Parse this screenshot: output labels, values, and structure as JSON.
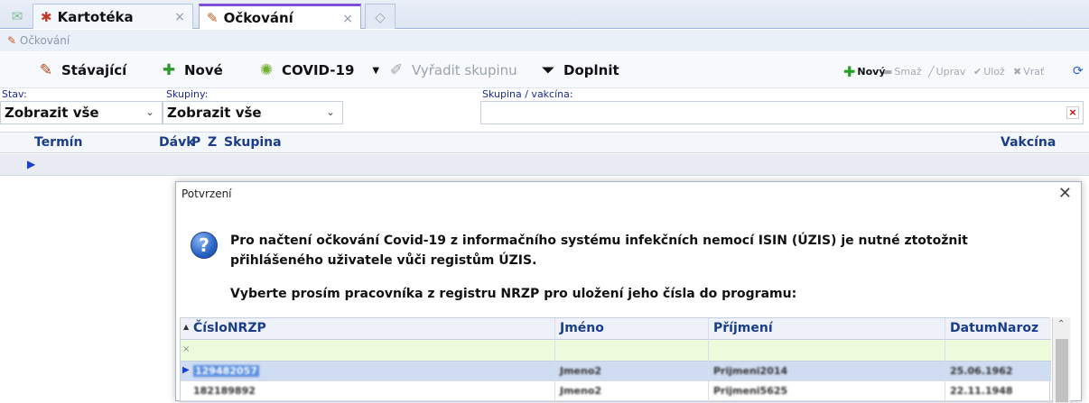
{
  "tabs": [
    {
      "label": "Kartotéka",
      "close": "×"
    },
    {
      "label": "Očkování",
      "close": "×"
    }
  ],
  "breadcrumb": "Očkování",
  "toolbar": {
    "existing": "Stávající",
    "new": "Nové",
    "covid": "COVID-19",
    "remove_group": "Vyřadit skupinu",
    "fill": "Doplnit",
    "r_new": "Nový",
    "r_delete": "Smaž",
    "r_edit": "Uprav",
    "r_save": "Ulož",
    "r_revert": "Vrať"
  },
  "filters": {
    "status_label": "Stav:",
    "status_value": "Zobrazit vše",
    "groups_label": "Skupiny:",
    "groups_value": "Zobrazit vše",
    "group_vaccine_label": "Skupina / vakcína:",
    "clear": "×"
  },
  "grid": {
    "columns": [
      "Termín",
      "Dávk",
      "P",
      "Z",
      "Skupina",
      "Vakcína"
    ]
  },
  "dialog": {
    "title": "Potvrzení",
    "close": "✕",
    "message": "Pro načtení očkování Covid-19 z informačního systému infekčních nemocí ISIN (ÚZIS) je nutné ztotožnit přihlášeného uživatele vůči registům ÚZIS.",
    "prompt": "Vyberte prosím pracovníka z registru NRZP pro uložení jeho čísla do programu:",
    "columns": [
      "ČísloNRZP",
      "Jméno",
      "Příjmení",
      "DatumNaroz"
    ],
    "rows": [
      [
        "129482057",
        "Jmeno2",
        "Prijmeni2014",
        "25.06.1962"
      ],
      [
        "182189892",
        "Jmeno2",
        "Prijmeni5625",
        "22.11.1948"
      ]
    ]
  }
}
